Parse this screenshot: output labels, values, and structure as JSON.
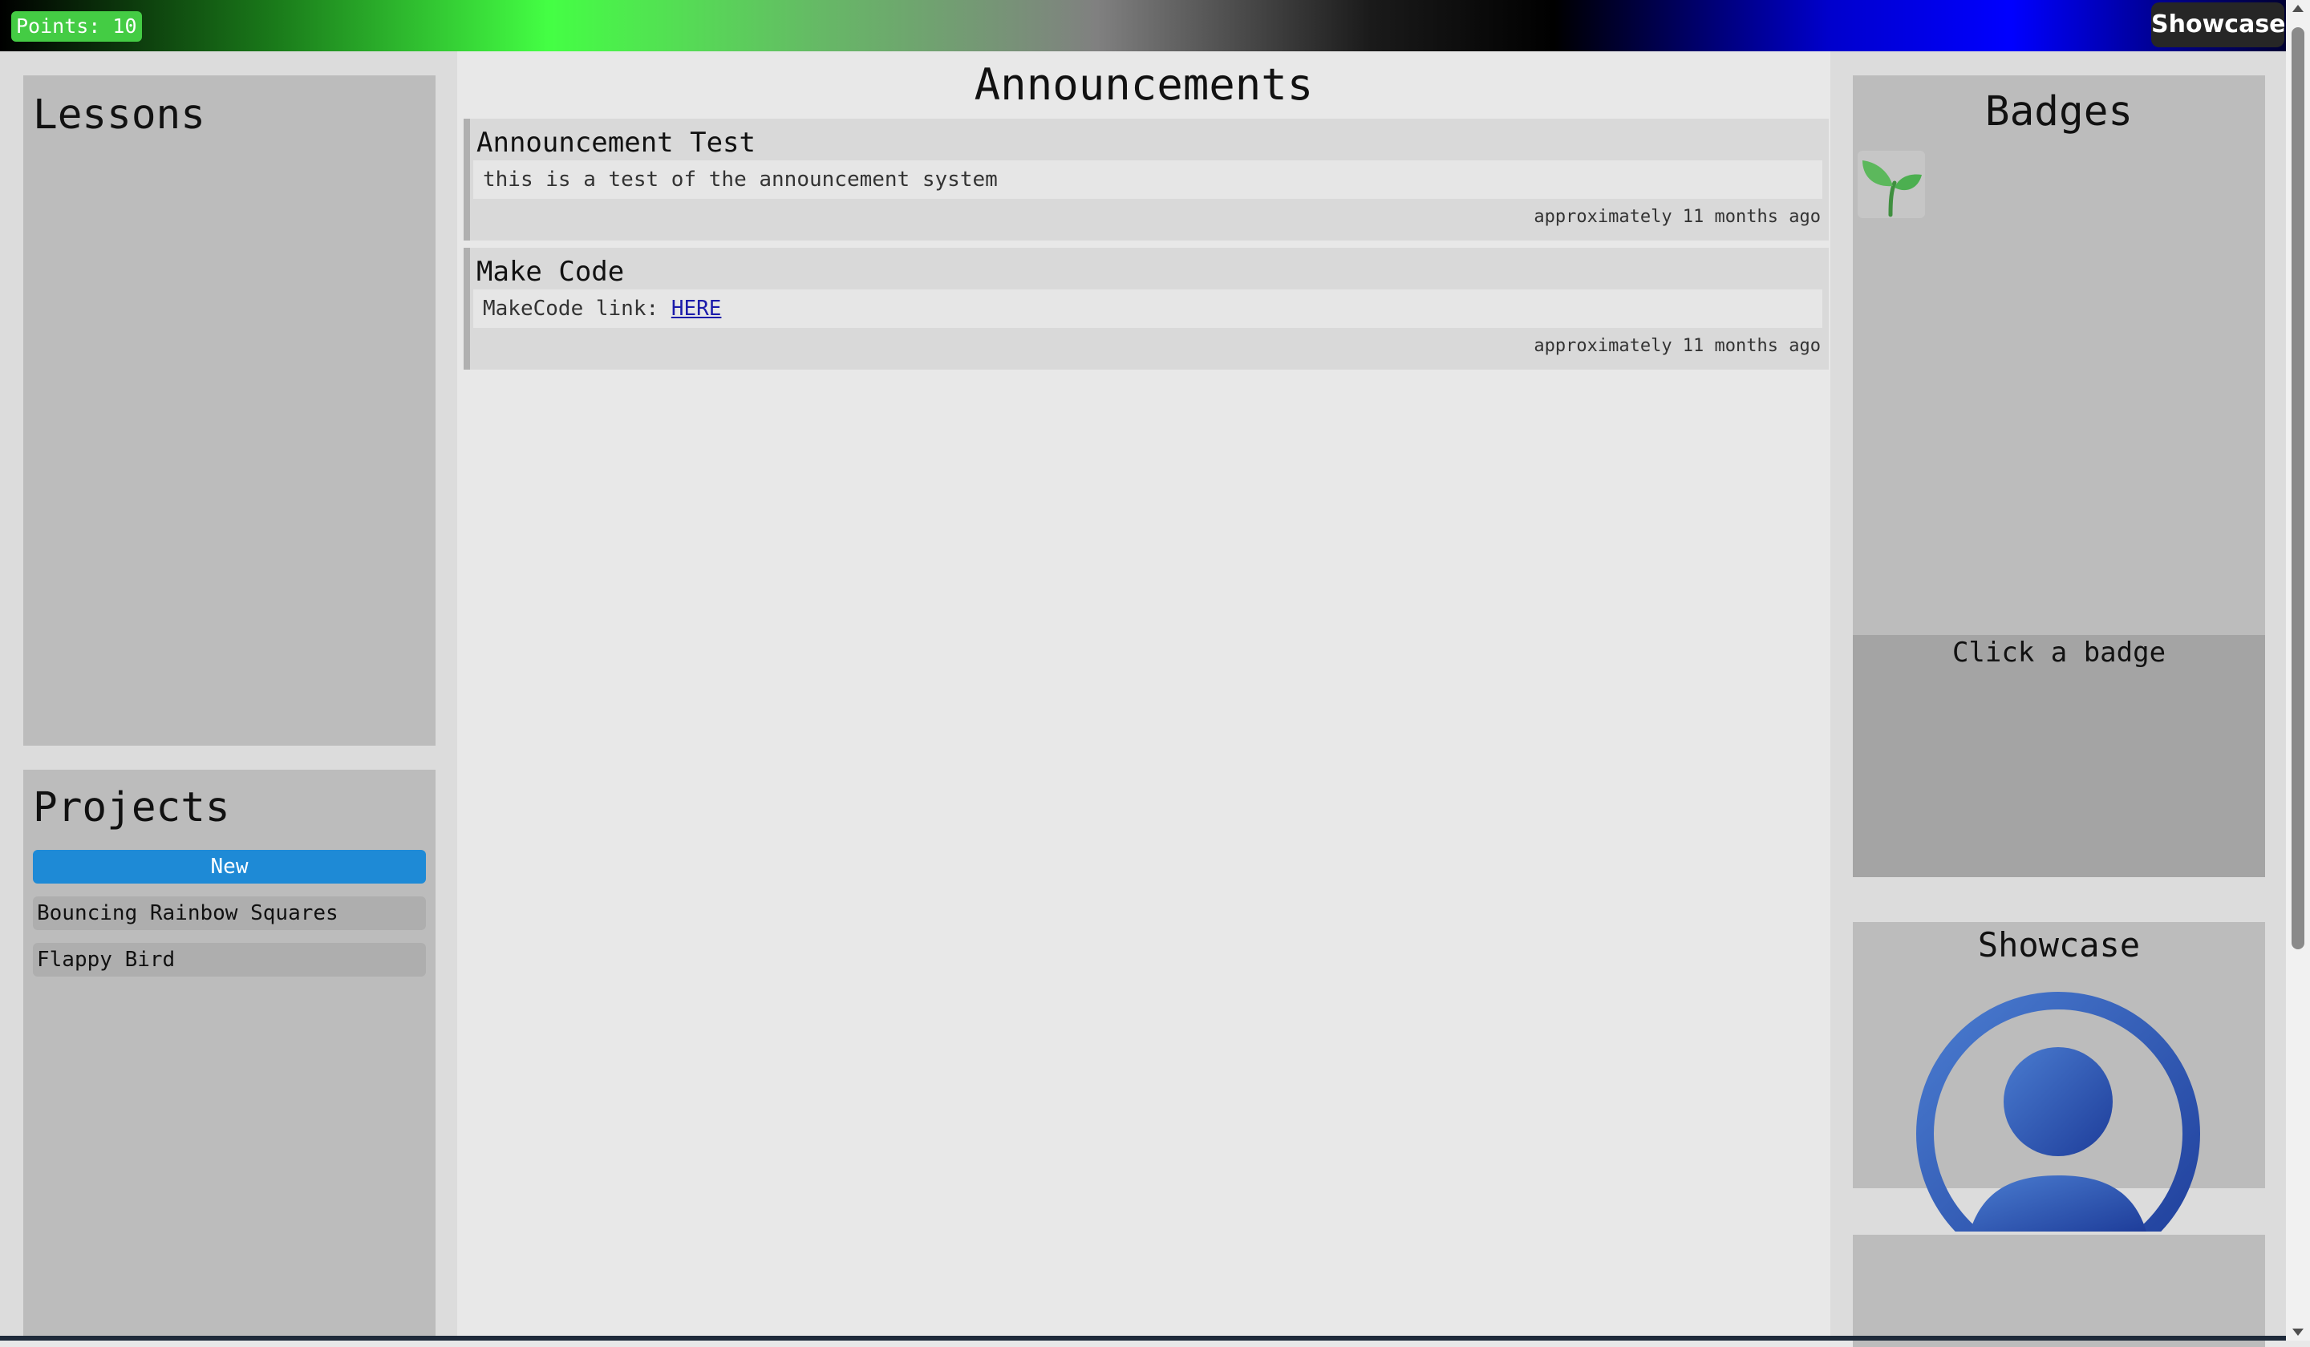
{
  "topbar": {
    "points_label": "Points: 10",
    "showcase_button": "Showcase"
  },
  "lessons": {
    "title": "Lessons"
  },
  "projects": {
    "title": "Projects",
    "new_button": "New",
    "items": [
      "Bouncing Rainbow Squares",
      "Flappy Bird"
    ]
  },
  "announcements": {
    "title": "Announcements",
    "items": [
      {
        "title": "Announcement Test",
        "body": "this is a test of the announcement system",
        "time": "approximately 11 months ago"
      },
      {
        "title": "Make Code",
        "body_prefix": "MakeCode link: ",
        "link_text": "HERE",
        "time": "approximately 11 months ago"
      }
    ]
  },
  "badges": {
    "title": "Badges",
    "items": [
      {
        "icon": "sprout-icon"
      }
    ],
    "detail_hint": "Click a badge"
  },
  "showcase": {
    "title": "Showcase",
    "avatar_icon": "user-avatar-icon"
  },
  "colors": {
    "points_green": "#44cc44",
    "new_button_blue": "#1e8ad6",
    "avatar_blue": "#3a63b8"
  }
}
